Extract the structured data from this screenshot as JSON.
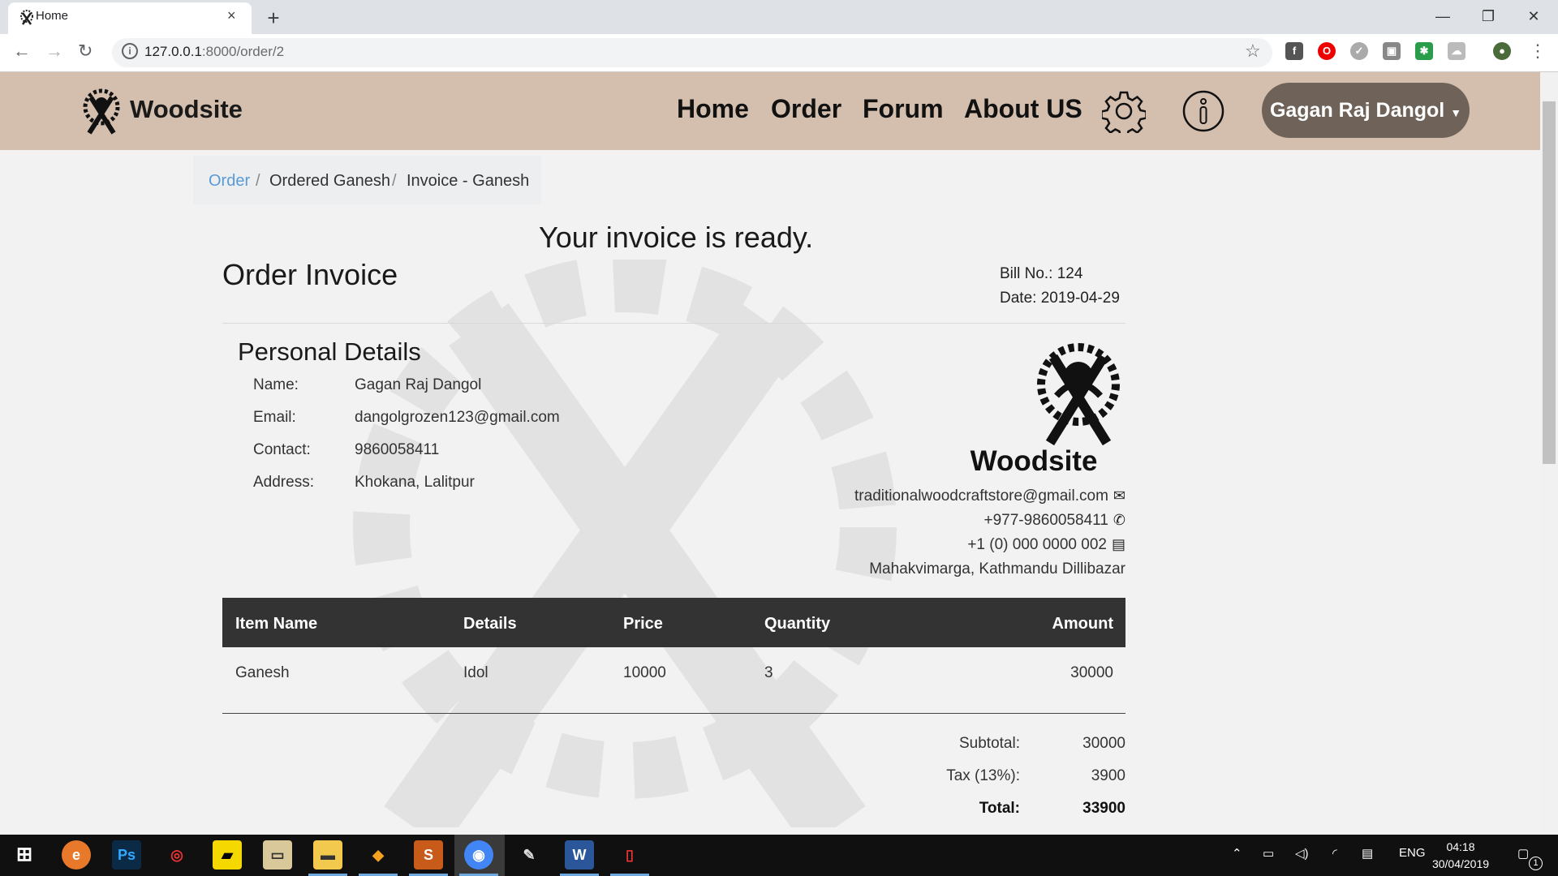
{
  "browser": {
    "tab_title": "Home",
    "tab_close": "×",
    "new_tab": "+",
    "url_host": "127.0.0.1",
    "url_rest": ":8000/order/2",
    "window_controls": [
      "—",
      "❐",
      "✕"
    ]
  },
  "navbar": {
    "brand": "Woodsite",
    "links": [
      "Home",
      "Order",
      "Forum",
      "About US"
    ],
    "user": "Gagan Raj Dangol"
  },
  "breadcrumb": {
    "order": "Order",
    "sep": "/",
    "ordered": "Ordered Ganesh",
    "invoice": "Invoice - Ganesh"
  },
  "invoice": {
    "heading": "Your invoice is ready.",
    "title": "Order Invoice",
    "bill_no": "Bill No.: 124",
    "date": "Date: 2019-04-29",
    "personal_title": "Personal Details",
    "personal": [
      {
        "label": "Name:",
        "value": "Gagan Raj Dangol"
      },
      {
        "label": "Email:",
        "value": "dangolgrozen123@gmail.com"
      },
      {
        "label": "Contact:",
        "value": "9860058411"
      },
      {
        "label": "Address:",
        "value": "Khokana, Lalitpur"
      }
    ],
    "company": {
      "name": "Woodsite",
      "email": "traditionalwoodcraftstore@gmail.com",
      "phone": "+977-9860058411",
      "fax": "+1 (0) 000 0000 002",
      "address": "Mahakvimarga, Kathmandu Dillibazar"
    },
    "table": {
      "headers": [
        "Item Name",
        "Details",
        "Price",
        "Quantity",
        "Amount"
      ],
      "rows": [
        [
          "Ganesh",
          "Idol",
          "10000",
          "3",
          "30000"
        ]
      ]
    },
    "summary": {
      "subtotal_label": "Subtotal:",
      "subtotal": "30000",
      "tax_label": "Tax (13%):",
      "tax": "3900",
      "total_label": "Total:",
      "total": "33900"
    }
  },
  "taskbar": {
    "lang": "ENG",
    "time": "04:18",
    "date": "30/04/2019",
    "notif": "1"
  },
  "colors": {
    "navbar_bg": "#d4bfae",
    "user_button_bg": "#6f6258",
    "table_header_bg": "#333333",
    "breadcrumb_link": "#5a9bd5"
  }
}
